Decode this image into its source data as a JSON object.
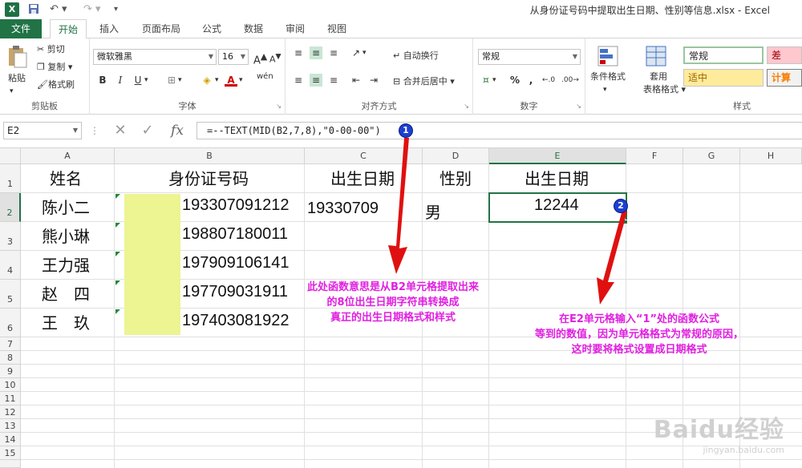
{
  "titlebar": {
    "app_icon": "X",
    "window_title": "从身份证号码中提取出生日期、性别等信息.xlsx - Excel",
    "save_icon": "save-icon",
    "undo_icon": "undo-icon",
    "redo_icon": "redo-icon"
  },
  "tabs": [
    "文件",
    "开始",
    "插入",
    "页面布局",
    "公式",
    "数据",
    "审阅",
    "视图"
  ],
  "active_tab": "开始",
  "ribbon": {
    "clipboard": {
      "paste": "粘贴",
      "cut": "剪切",
      "copy": "复制",
      "format_painter": "格式刷",
      "label": "剪贴板"
    },
    "font": {
      "name": "微软雅黑",
      "size": "16",
      "bold": "B",
      "italic": "I",
      "underline": "U",
      "wen": "wén",
      "label": "字体"
    },
    "alignment": {
      "wrap": "自动换行",
      "merge": "合并后居中",
      "label": "对齐方式"
    },
    "number": {
      "format": "常规",
      "percent": "%",
      "comma": ",",
      "label": "数字"
    },
    "styles": {
      "conditional": "条件格式",
      "table": "套用",
      "table2": "表格格式",
      "normal": "常规",
      "bad": "差",
      "neutral": "适中",
      "calc": "计算",
      "label": "样式"
    }
  },
  "formula_bar": {
    "name_box": "E2",
    "cancel": "✕",
    "enter": "✓",
    "fx": "fx",
    "formula": "=--TEXT(MID(B2,7,8),\"0-00-00\")"
  },
  "columns": [
    "A",
    "B",
    "C",
    "D",
    "E",
    "F",
    "G",
    "H"
  ],
  "rows": [
    "1",
    "2",
    "3",
    "4",
    "5",
    "6",
    "7",
    "8",
    "9",
    "10",
    "11",
    "12",
    "13",
    "14",
    "15"
  ],
  "sheet": {
    "header": {
      "a": "姓名",
      "b": "身份证号码",
      "c": "出生日期",
      "d": "性别",
      "e": "出生日期"
    },
    "data": [
      {
        "name": "陈小二",
        "id": "193307091212",
        "birth": "19330709",
        "gender": "男",
        "e": "12244"
      },
      {
        "name": "熊小琳",
        "id": "198807180011"
      },
      {
        "name": "王力强",
        "id": "197909106141"
      },
      {
        "name": "赵　四",
        "id": "197709031911"
      },
      {
        "name": "王　玖",
        "id": "197403081922"
      }
    ]
  },
  "annotations": {
    "badge1": "1",
    "badge2": "2",
    "note1": [
      "此处函数意思是从B2单元格提取出来",
      "的8位出生日期字符串转换成",
      "真正的出生日期格式和样式"
    ],
    "note2": [
      "在E2单元格输入“1”处的函数公式",
      "等到的数值，因为单元格格式为常规的原因，",
      "这时要将格式设置成日期格式"
    ],
    "arrow_color": "#e01010",
    "text_color": "#e020e0"
  },
  "watermark": {
    "brand": "Baidu经验",
    "url": "jingyan.baidu.com"
  }
}
